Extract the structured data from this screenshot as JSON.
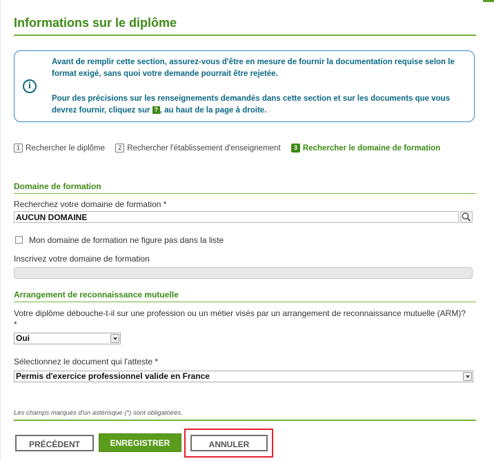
{
  "header": {
    "title": "Informations sur le diplôme"
  },
  "info_box": {
    "paragraph1": "Avant de remplir cette section, assurez-vous d'être en mesure de fournir la documentation requise selon le format exigé, sans quoi votre demande pourrait être rejetée.",
    "paragraph2_before": "Pour des précisions sur les renseignements demandés dans cette section et sur les documents que vous devrez fournir, cliquez sur",
    "help_badge": "?",
    "paragraph2_after": ", au haut de la page à droite.",
    "icon": "info-circle-icon"
  },
  "steps": [
    {
      "number": "1",
      "label": "Rechercher le diplôme",
      "active": false
    },
    {
      "number": "2",
      "label": "Rechercher l'établissement d'enseignement",
      "active": false
    },
    {
      "number": "3",
      "label": "Rechercher le domaine de formation",
      "active": true
    }
  ],
  "domaine": {
    "section_title": "Domaine de formation",
    "search_label": "Recherchez votre domaine de formation *",
    "search_value": "AUCUN DOMAINE",
    "search_icon": "magnifier-icon",
    "checkbox_label": "Mon domaine de formation ne figure pas dans la liste",
    "checkbox_checked": false,
    "write_label": "Inscrivez votre domaine de formation",
    "write_value": ""
  },
  "arm": {
    "section_title": "Arrangement de reconnaissance mutuelle",
    "question_label": "Votre diplôme débouche-t-il sur une profession ou un métier visés par un arrangement de reconnaissance mutuelle (ARM)? *",
    "question_value": "Oui",
    "document_label": "Sélectionnez le document qui l'atteste *",
    "document_value": "Permis d'exercice professionnel valide en France"
  },
  "footer": {
    "required_note": "Les champs marqués d'un astérisque (*) sont obligatoires.",
    "prev_label": "PRÉCÉDENT",
    "save_label": "ENREGISTRER",
    "cancel_label": "ANNULER"
  },
  "colors": {
    "accent_green": "#3e8a16",
    "info_blue": "#0e6a85",
    "highlight_red": "#e5202f"
  }
}
